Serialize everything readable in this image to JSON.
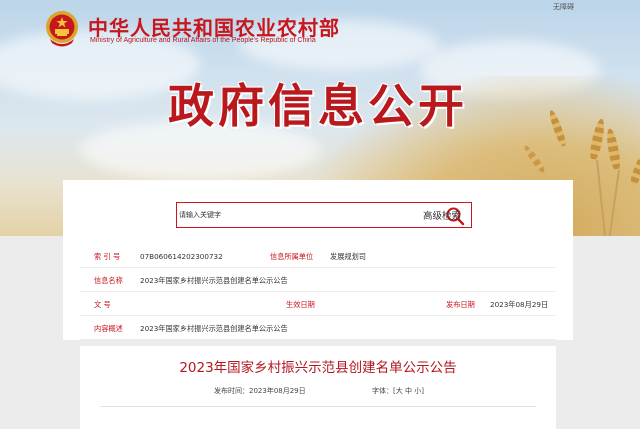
{
  "header": {
    "site_title": "中华人民共和国农业农村部",
    "site_title_en": "Ministry of Agriculture and Rural Affairs of the People's Republic of China",
    "top_link": "无障碍",
    "banner_title": "政府信息公开"
  },
  "search": {
    "placeholder": "请输入关键字",
    "advanced_label": "高级检索"
  },
  "info": {
    "index_label": "索 引 号",
    "index_value": "07B060614202300732",
    "dept_label": "信息所属单位",
    "dept_value": "发展规划司",
    "name_label": "信息名称",
    "name_value": "2023年国家乡村振兴示范县创建名单公示公告",
    "doc_no_label": "文 号",
    "doc_no_value": "",
    "effective_label": "生效日期",
    "effective_value": "",
    "publish_label": "发布日期",
    "publish_value": "2023年08月29日",
    "summary_label": "内容概述",
    "summary_value": "2023年国家乡村振兴示范县创建名单公示公告"
  },
  "article": {
    "title": "2023年国家乡村振兴示范县创建名单公示公告",
    "publish_prefix": "发布时间：",
    "publish_date": "2023年08月29日",
    "font_label": "字体：",
    "bracket_open": "[",
    "font_large": "大",
    "font_medium": "中",
    "font_small": "小",
    "bracket_close": "]"
  },
  "colors": {
    "brand_red": "#c8161d",
    "panel_bg": "#ffffff",
    "page_bg": "#ececec"
  },
  "icons": {
    "emblem": "national-emblem-icon",
    "search": "search-icon"
  }
}
